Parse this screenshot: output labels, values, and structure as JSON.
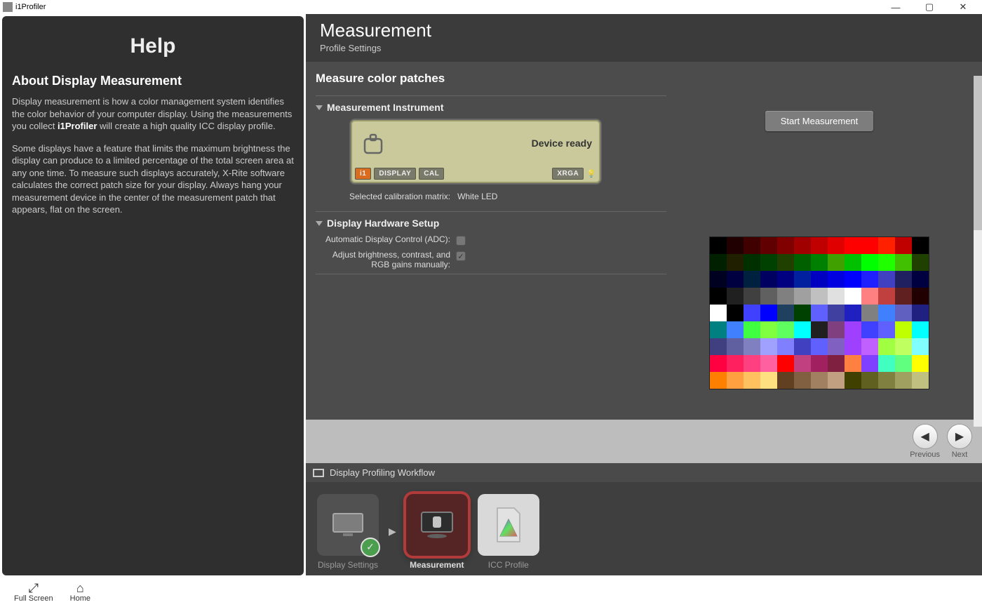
{
  "window": {
    "title": "i1Profiler"
  },
  "help": {
    "title": "Help",
    "heading": "About Display Measurement",
    "para1a": "Display measurement is how a color management system identifies the color behavior of your computer display. Using the measurements you collect ",
    "para1b": "i1Profiler",
    "para1c": " will create a high quality ICC display profile.",
    "para2": "Some displays have a feature that limits the maximum brightness the display can produce to a limited percentage of the total screen area at any one time. To measure such displays accurately, X-Rite software calculates the correct patch size for your display. Always hang your measurement device in the center of the measurement patch that appears, flat on the screen."
  },
  "main": {
    "title": "Measurement",
    "subtitle": "Profile Settings",
    "section_title": "Measure color patches",
    "instrument_header": "Measurement Instrument",
    "device_status": "Device ready",
    "tags": {
      "i1": "i1",
      "display": "DISPLAY",
      "cal": "CAL",
      "xrga": "XRGA"
    },
    "cal_matrix_label": "Selected calibration matrix:",
    "cal_matrix_value": "White LED",
    "hw_header": "Display Hardware Setup",
    "adc_label": "Automatic Display Control (ADC):",
    "manual_label": "Adjust brightness, contrast, and RGB gains manually:",
    "start_button": "Start Measurement"
  },
  "nav": {
    "prev": "Previous",
    "next": "Next"
  },
  "workflow": {
    "title": "Display Profiling Workflow",
    "steps": {
      "display_settings": "Display Settings",
      "measurement": "Measurement",
      "icc_profile": "ICC Profile"
    }
  },
  "bottom": {
    "full_screen": "Full Screen",
    "home": "Home"
  },
  "patches": [
    [
      "#000000",
      "#200000",
      "#400000",
      "#600000",
      "#800000",
      "#a00000",
      "#c00000",
      "#e00000",
      "#ff0000",
      "#ff0000",
      "#ff2000",
      "#c00000",
      "#000000"
    ],
    [
      "#002000",
      "#202000",
      "#003000",
      "#004000",
      "#204000",
      "#006000",
      "#008000",
      "#40a000",
      "#00c000",
      "#00ff00",
      "#20ff00",
      "#40c000",
      "#204000"
    ],
    [
      "#000020",
      "#000040",
      "#002040",
      "#000060",
      "#000080",
      "#0020a0",
      "#0000c0",
      "#0000e0",
      "#0000ff",
      "#2020ff",
      "#4040c0",
      "#202060",
      "#000040"
    ],
    [
      "#000000",
      "#202020",
      "#404040",
      "#606060",
      "#808080",
      "#a0a0a0",
      "#c0c0c0",
      "#e0e0e0",
      "#ffffff",
      "#ff8080",
      "#c04040",
      "#602020",
      "#200000"
    ],
    [
      "#ffffff",
      "#000000",
      "#4040ff",
      "#0000ff",
      "#204060",
      "#004000",
      "#6060ff",
      "#4040a0",
      "#2020c0",
      "#808080",
      "#4080ff",
      "#6060c0",
      "#202080"
    ],
    [
      "#008080",
      "#4080ff",
      "#40ff40",
      "#80ff40",
      "#60ff60",
      "#00ffff",
      "#202020",
      "#804080",
      "#a040ff",
      "#4040ff",
      "#6060ff",
      "#c0ff00",
      "#00ffff"
    ],
    [
      "#404080",
      "#6060a0",
      "#8080c0",
      "#a0a0ff",
      "#8080ff",
      "#4040c0",
      "#6060ff",
      "#8060c0",
      "#a040ff",
      "#c060ff",
      "#a0ff40",
      "#c0ff60",
      "#80ffff"
    ],
    [
      "#ff0040",
      "#ff2060",
      "#ff4080",
      "#ff60a0",
      "#ff0000",
      "#c04080",
      "#a02060",
      "#802040",
      "#ff8040",
      "#8040ff",
      "#40ffc0",
      "#60ff80",
      "#ffff00"
    ],
    [
      "#ff8000",
      "#ffa040",
      "#ffc060",
      "#ffe080",
      "#604020",
      "#806040",
      "#a08060",
      "#c0a080",
      "#404000",
      "#606020",
      "#808040",
      "#a0a060",
      "#c0c080"
    ]
  ]
}
